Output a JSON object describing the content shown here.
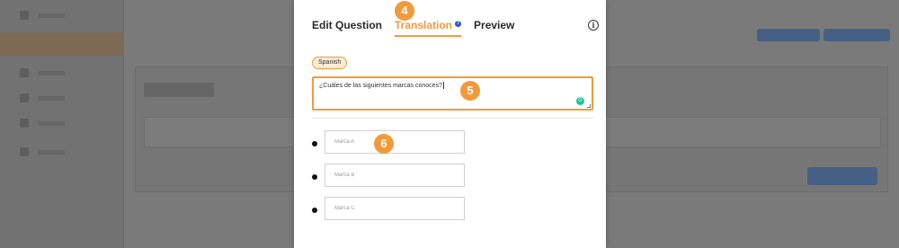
{
  "modal": {
    "tabs": [
      {
        "label": "Edit Question"
      },
      {
        "label": "Translation"
      },
      {
        "label": "Preview"
      }
    ],
    "help_icon": "?",
    "info_icon": "i",
    "language_chip": "Spanish",
    "question_text": "¿Cuáles de las siguientes marcas conoces?",
    "grammar_icon": "G",
    "options": [
      {
        "placeholder": "Marca A"
      },
      {
        "placeholder": "Marca B"
      },
      {
        "placeholder": "Marca C"
      }
    ]
  },
  "steps": {
    "tab_step": "4",
    "question_step": "5",
    "options_step": "6"
  },
  "colors": {
    "accent": "#f29a3a",
    "help_dot": "#2f53d9",
    "grammar": "#15c39a"
  },
  "icons": [
    "help-icon",
    "info-icon",
    "grammar-icon",
    "resize-handle-icon"
  ]
}
